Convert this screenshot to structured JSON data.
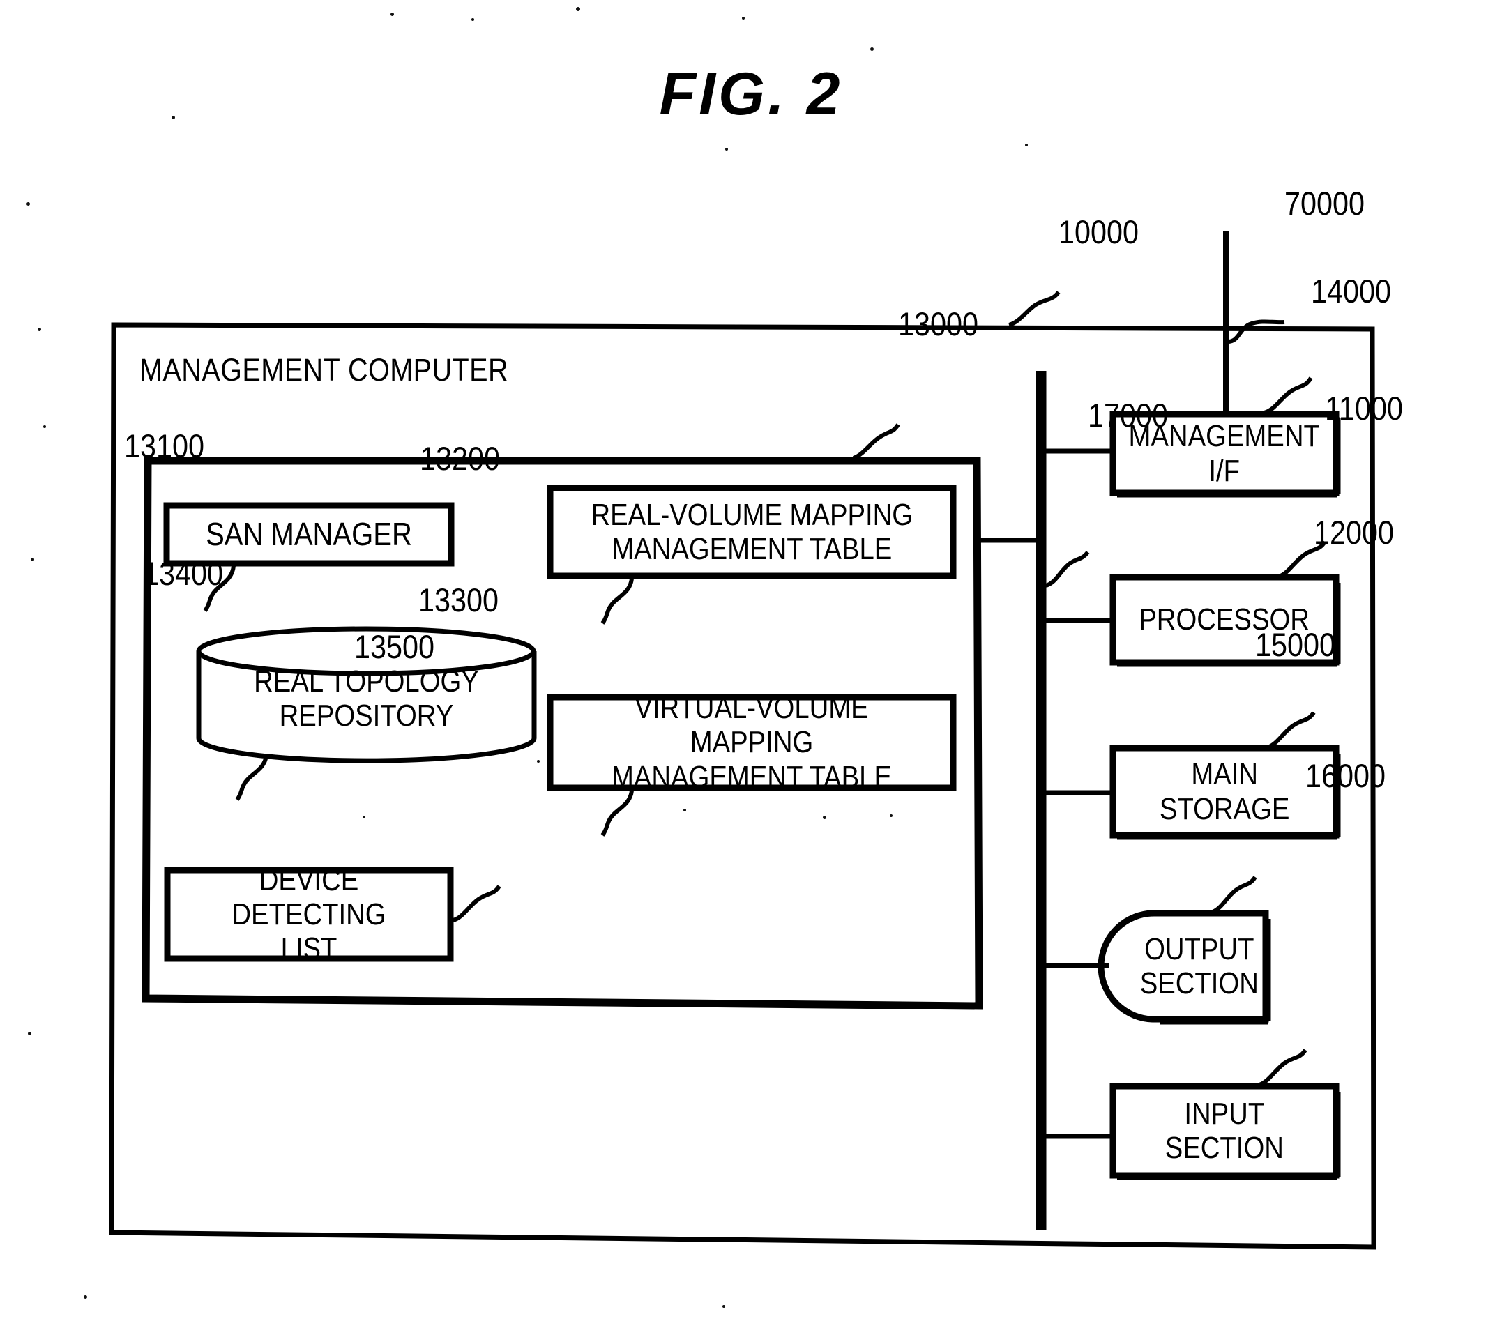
{
  "figure": {
    "title": "FIG. 2",
    "outer_label": "MANAGEMENT COMPUTER",
    "outer_ref": "10000",
    "external_network_ref": "70000",
    "bus_ref": "17000"
  },
  "software_block": {
    "ref": "13000",
    "items": [
      {
        "name": "san-manager",
        "label": "SAN MANAGER",
        "ref": "13100",
        "shape": "rect"
      },
      {
        "name": "real-volume-mapping-management-table",
        "label": "REAL-VOLUME MAPPING\nMANAGEMENT TABLE",
        "ref": "13200",
        "shape": "rect"
      },
      {
        "name": "real-topology-repository",
        "label": "REAL TOPOLOGY\nREPOSITORY",
        "ref": "13400",
        "shape": "cylinder"
      },
      {
        "name": "virtual-volume-mapping-management-table",
        "label": "VIRTUAL-VOLUME MAPPING\nMANAGEMENT TABLE",
        "ref": "13300",
        "shape": "rect"
      },
      {
        "name": "device-detecting-list",
        "label": "DEVICE DETECTING\nLIST",
        "ref": "13500",
        "shape": "rect"
      }
    ]
  },
  "hardware_column": {
    "items": [
      {
        "name": "management-if",
        "label": "MANAGEMENT\nI/F",
        "ref": "14000",
        "shape": "rect"
      },
      {
        "name": "processor",
        "label": "PROCESSOR",
        "ref": "11000",
        "shape": "rect"
      },
      {
        "name": "main-storage",
        "label": "MAIN\nSTORAGE",
        "ref": "12000",
        "shape": "rect"
      },
      {
        "name": "output-section",
        "label": "OUTPUT\nSECTION",
        "ref": "15000",
        "shape": "d-shape-left"
      },
      {
        "name": "input-section",
        "label": "INPUT\nSECTION",
        "ref": "16000",
        "shape": "rect"
      }
    ]
  },
  "colors": {
    "ink": "#000000",
    "paper": "#ffffff"
  }
}
